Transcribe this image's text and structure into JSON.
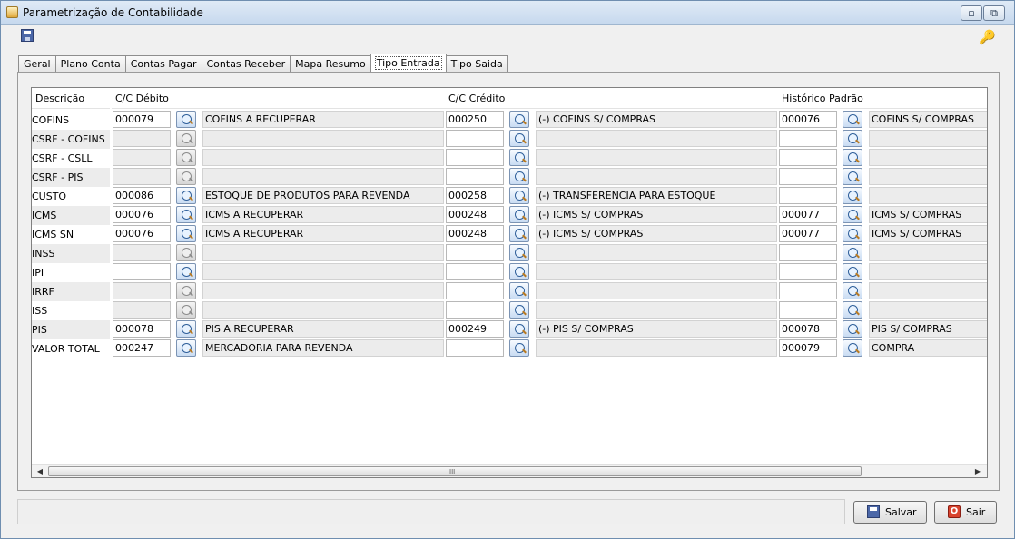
{
  "window": {
    "title": "Parametrização de Contabilidade",
    "minimize_glyph": "▫",
    "maximize_glyph": "⧉",
    "close_glyph": "✕"
  },
  "icons": {
    "save": "save-icon",
    "key": "key-icon",
    "lookup": "magnifier-icon"
  },
  "tabs": [
    {
      "label": "Geral",
      "active": false
    },
    {
      "label": "Plano Conta",
      "active": false
    },
    {
      "label": "Contas Pagar",
      "active": false
    },
    {
      "label": "Contas Receber",
      "active": false
    },
    {
      "label": "Mapa Resumo",
      "active": false
    },
    {
      "label": "Tipo Entrada",
      "active": true
    },
    {
      "label": "Tipo Saida",
      "active": false
    }
  ],
  "table": {
    "headers": {
      "descricao": "Descrição",
      "debito": "C/C Débito",
      "credito": "C/C Crédito",
      "historico": "Histórico Padrão"
    },
    "rows": [
      {
        "label": "COFINS",
        "deb_enabled": true,
        "deb_code": "000079",
        "deb_desc": "COFINS A RECUPERAR",
        "cred_code": "000250",
        "cred_desc": "(-) COFINS S/ COMPRAS",
        "hist_code": "000076",
        "hist_desc": "COFINS S/  COMPRAS"
      },
      {
        "label": "CSRF - COFINS",
        "deb_enabled": false,
        "deb_code": "",
        "deb_desc": "",
        "cred_code": "",
        "cred_desc": "",
        "hist_code": "",
        "hist_desc": ""
      },
      {
        "label": "CSRF - CSLL",
        "deb_enabled": false,
        "deb_code": "",
        "deb_desc": "",
        "cred_code": "",
        "cred_desc": "",
        "hist_code": "",
        "hist_desc": ""
      },
      {
        "label": "CSRF - PIS",
        "deb_enabled": false,
        "deb_code": "",
        "deb_desc": "",
        "cred_code": "",
        "cred_desc": "",
        "hist_code": "",
        "hist_desc": ""
      },
      {
        "label": "CUSTO",
        "deb_enabled": true,
        "deb_code": "000086",
        "deb_desc": "ESTOQUE DE PRODUTOS PARA REVENDA",
        "cred_code": "000258",
        "cred_desc": "(-) TRANSFERENCIA PARA ESTOQUE",
        "hist_code": "",
        "hist_desc": ""
      },
      {
        "label": "ICMS",
        "deb_enabled": true,
        "deb_code": "000076",
        "deb_desc": "ICMS A RECUPERAR",
        "cred_code": "000248",
        "cred_desc": "(-) ICMS S/ COMPRAS",
        "hist_code": "000077",
        "hist_desc": "ICMS S/ COMPRAS"
      },
      {
        "label": "ICMS SN",
        "deb_enabled": true,
        "deb_code": "000076",
        "deb_desc": "ICMS A RECUPERAR",
        "cred_code": "000248",
        "cred_desc": "(-) ICMS S/ COMPRAS",
        "hist_code": "000077",
        "hist_desc": "ICMS S/ COMPRAS"
      },
      {
        "label": "INSS",
        "deb_enabled": false,
        "deb_code": "",
        "deb_desc": "",
        "cred_code": "",
        "cred_desc": "",
        "hist_code": "",
        "hist_desc": ""
      },
      {
        "label": "IPI",
        "deb_enabled": true,
        "deb_code": "",
        "deb_desc": "",
        "cred_code": "",
        "cred_desc": "",
        "hist_code": "",
        "hist_desc": ""
      },
      {
        "label": "IRRF",
        "deb_enabled": false,
        "deb_code": "",
        "deb_desc": "",
        "cred_code": "",
        "cred_desc": "",
        "hist_code": "",
        "hist_desc": ""
      },
      {
        "label": "ISS",
        "deb_enabled": false,
        "deb_code": "",
        "deb_desc": "",
        "cred_code": "",
        "cred_desc": "",
        "hist_code": "",
        "hist_desc": ""
      },
      {
        "label": "PIS",
        "deb_enabled": true,
        "deb_code": "000078",
        "deb_desc": "PIS A RECUPERAR",
        "cred_code": "000249",
        "cred_desc": "(-) PIS S/ COMPRAS",
        "hist_code": "000078",
        "hist_desc": "PIS S/ COMPRAS"
      },
      {
        "label": "VALOR TOTAL",
        "deb_enabled": true,
        "deb_code": "000247",
        "deb_desc": "MERCADORIA PARA REVENDA",
        "cred_code": "",
        "cred_desc": "",
        "hist_code": "000079",
        "hist_desc": "COMPRA"
      }
    ]
  },
  "scrollbar": {
    "left_arrow": "◀",
    "right_arrow": "▶",
    "grip": "III"
  },
  "buttons": {
    "save_label": "Salvar",
    "exit_label": "Sair",
    "exit_glyph": "O"
  }
}
